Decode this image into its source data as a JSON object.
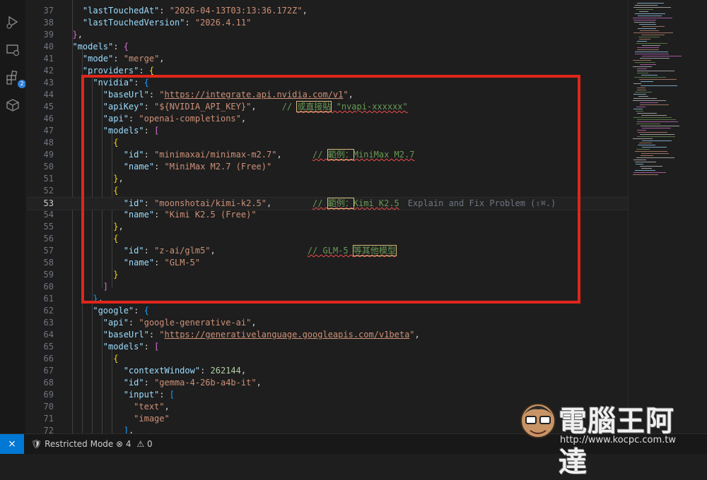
{
  "activity_bar": {
    "extensions_badge": "2"
  },
  "editor": {
    "lines": [
      {
        "n": "37",
        "tokens": [
          [
            "p",
            "    "
          ],
          [
            "k",
            "\"lastTouchedAt\""
          ],
          [
            "p",
            ": "
          ],
          [
            "s",
            "\"2026-04-13T03:13:36.172Z\""
          ],
          [
            "p",
            ","
          ]
        ]
      },
      {
        "n": "38",
        "tokens": [
          [
            "p",
            "    "
          ],
          [
            "k",
            "\"lastTouchedVersion\""
          ],
          [
            "p",
            ": "
          ],
          [
            "s",
            "\"2026.4.11\""
          ]
        ]
      },
      {
        "n": "39",
        "tokens": [
          [
            "p",
            "  "
          ],
          [
            "b1",
            "}"
          ],
          [
            "p",
            ","
          ]
        ]
      },
      {
        "n": "40",
        "tokens": [
          [
            "p",
            "  "
          ],
          [
            "k",
            "\"models\""
          ],
          [
            "p",
            ": "
          ],
          [
            "b1",
            "{"
          ]
        ]
      },
      {
        "n": "41",
        "tokens": [
          [
            "p",
            "    "
          ],
          [
            "k",
            "\"mode\""
          ],
          [
            "p",
            ": "
          ],
          [
            "s",
            "\"merge\""
          ],
          [
            "p",
            ","
          ]
        ]
      },
      {
        "n": "42",
        "tokens": [
          [
            "p",
            "    "
          ],
          [
            "k",
            "\"providers\""
          ],
          [
            "p",
            ": "
          ],
          [
            "b2",
            "{"
          ]
        ]
      },
      {
        "n": "43",
        "tokens": [
          [
            "p",
            "      "
          ],
          [
            "k",
            "\"nvidia\""
          ],
          [
            "p",
            ": "
          ],
          [
            "b3",
            "{"
          ]
        ]
      },
      {
        "n": "44",
        "tokens": [
          [
            "p",
            "        "
          ],
          [
            "k",
            "\"baseUrl\""
          ],
          [
            "p",
            ": "
          ],
          [
            "s",
            "\""
          ],
          [
            "s url",
            "https://integrate.api.nvidia.com/v1"
          ],
          [
            "s",
            "\""
          ],
          [
            "p",
            ","
          ]
        ]
      },
      {
        "n": "45",
        "tokens": [
          [
            "p",
            "        "
          ],
          [
            "k",
            "\"apiKey\""
          ],
          [
            "p",
            ": "
          ],
          [
            "s",
            "\"${NVIDIA_API_KEY}\""
          ],
          [
            "p",
            ",     "
          ],
          [
            "c",
            "// "
          ],
          [
            "c squig box",
            "或直接貼"
          ],
          [
            "c squig",
            " \"nvapi-xxxxxx\""
          ]
        ]
      },
      {
        "n": "46",
        "tokens": [
          [
            "p",
            "        "
          ],
          [
            "k",
            "\"api\""
          ],
          [
            "p",
            ": "
          ],
          [
            "s",
            "\"openai-completions\""
          ],
          [
            "p",
            ","
          ]
        ]
      },
      {
        "n": "47",
        "tokens": [
          [
            "p",
            "        "
          ],
          [
            "k",
            "\"models\""
          ],
          [
            "p",
            ": "
          ],
          [
            "b1",
            "["
          ]
        ]
      },
      {
        "n": "48",
        "tokens": [
          [
            "p",
            "          "
          ],
          [
            "b2",
            "{"
          ]
        ]
      },
      {
        "n": "49",
        "tokens": [
          [
            "p",
            "            "
          ],
          [
            "k",
            "\"id\""
          ],
          [
            "p",
            ": "
          ],
          [
            "s",
            "\"minimaxai/minimax-m2.7\""
          ],
          [
            "p",
            ",      "
          ],
          [
            "c squig",
            "// "
          ],
          [
            "c squig box",
            "範例："
          ],
          [
            "c squig",
            "MiniMax M2.7"
          ]
        ]
      },
      {
        "n": "50",
        "tokens": [
          [
            "p",
            "            "
          ],
          [
            "k",
            "\"name\""
          ],
          [
            "p",
            ": "
          ],
          [
            "s",
            "\"MiniMax M2.7 (Free)\""
          ]
        ]
      },
      {
        "n": "51",
        "tokens": [
          [
            "p",
            "          "
          ],
          [
            "b2",
            "}"
          ],
          [
            "p",
            ","
          ]
        ]
      },
      {
        "n": "52",
        "tokens": [
          [
            "p",
            "          "
          ],
          [
            "b2",
            "{"
          ]
        ]
      },
      {
        "n": "53",
        "tokens": [
          [
            "p",
            "            "
          ],
          [
            "k",
            "\"id\""
          ],
          [
            "p",
            ": "
          ],
          [
            "s",
            "\"moonshotai/kimi-k2.5\""
          ],
          [
            "p",
            ",        "
          ],
          [
            "c squig",
            "// "
          ],
          [
            "c squig box",
            "範例："
          ],
          [
            "c squig",
            "Kimi K2.5"
          ],
          [
            "hint",
            "Explain and Fix Problem (⇧⌘.)"
          ]
        ],
        "active": true
      },
      {
        "n": "54",
        "tokens": [
          [
            "p",
            "            "
          ],
          [
            "k",
            "\"name\""
          ],
          [
            "p",
            ": "
          ],
          [
            "s",
            "\"Kimi K2.5 (Free)\""
          ]
        ]
      },
      {
        "n": "55",
        "tokens": [
          [
            "p",
            "          "
          ],
          [
            "b2",
            "}"
          ],
          [
            "p",
            ","
          ]
        ]
      },
      {
        "n": "56",
        "tokens": [
          [
            "p",
            "          "
          ],
          [
            "b2",
            "{"
          ]
        ]
      },
      {
        "n": "57",
        "tokens": [
          [
            "p",
            "            "
          ],
          [
            "k",
            "\"id\""
          ],
          [
            "p",
            ": "
          ],
          [
            "s",
            "\"z-ai/glm5\""
          ],
          [
            "p",
            ",                  "
          ],
          [
            "c squig",
            "// GLM-5 "
          ],
          [
            "c squig box",
            "等其他模型"
          ]
        ]
      },
      {
        "n": "58",
        "tokens": [
          [
            "p",
            "            "
          ],
          [
            "k",
            "\"name\""
          ],
          [
            "p",
            ": "
          ],
          [
            "s",
            "\"GLM-5\""
          ]
        ]
      },
      {
        "n": "59",
        "tokens": [
          [
            "p",
            "          "
          ],
          [
            "b2",
            "}"
          ]
        ]
      },
      {
        "n": "60",
        "tokens": [
          [
            "p",
            "        "
          ],
          [
            "b1",
            "]"
          ]
        ]
      },
      {
        "n": "61",
        "tokens": [
          [
            "p",
            "      "
          ],
          [
            "b3",
            "}"
          ],
          [
            "p",
            ","
          ]
        ]
      },
      {
        "n": "62",
        "tokens": [
          [
            "p",
            "      "
          ],
          [
            "k",
            "\"google\""
          ],
          [
            "p",
            ": "
          ],
          [
            "b3",
            "{"
          ]
        ]
      },
      {
        "n": "63",
        "tokens": [
          [
            "p",
            "        "
          ],
          [
            "k",
            "\"api\""
          ],
          [
            "p",
            ": "
          ],
          [
            "s",
            "\"google-generative-ai\""
          ],
          [
            "p",
            ","
          ]
        ]
      },
      {
        "n": "64",
        "tokens": [
          [
            "p",
            "        "
          ],
          [
            "k",
            "\"baseUrl\""
          ],
          [
            "p",
            ": "
          ],
          [
            "s",
            "\""
          ],
          [
            "s url",
            "https://generativelanguage.googleapis.com/v1beta"
          ],
          [
            "s",
            "\""
          ],
          [
            "p",
            ","
          ]
        ]
      },
      {
        "n": "65",
        "tokens": [
          [
            "p",
            "        "
          ],
          [
            "k",
            "\"models\""
          ],
          [
            "p",
            ": "
          ],
          [
            "b1",
            "["
          ]
        ]
      },
      {
        "n": "66",
        "tokens": [
          [
            "p",
            "          "
          ],
          [
            "b2",
            "{"
          ]
        ]
      },
      {
        "n": "67",
        "tokens": [
          [
            "p",
            "            "
          ],
          [
            "k",
            "\"contextWindow\""
          ],
          [
            "p",
            ": "
          ],
          [
            "n",
            "262144"
          ],
          [
            "p",
            ","
          ]
        ]
      },
      {
        "n": "68",
        "tokens": [
          [
            "p",
            "            "
          ],
          [
            "k",
            "\"id\""
          ],
          [
            "p",
            ": "
          ],
          [
            "s",
            "\"gemma-4-26b-a4b-it\""
          ],
          [
            "p",
            ","
          ]
        ]
      },
      {
        "n": "69",
        "tokens": [
          [
            "p",
            "            "
          ],
          [
            "k",
            "\"input\""
          ],
          [
            "p",
            ": "
          ],
          [
            "b3",
            "["
          ]
        ]
      },
      {
        "n": "70",
        "tokens": [
          [
            "p",
            "              "
          ],
          [
            "s",
            "\"text\""
          ],
          [
            "p",
            ","
          ]
        ]
      },
      {
        "n": "71",
        "tokens": [
          [
            "p",
            "              "
          ],
          [
            "s",
            "\"image\""
          ]
        ]
      },
      {
        "n": "72",
        "tokens": [
          [
            "p",
            "            "
          ],
          [
            "b3",
            "]"
          ],
          [
            "p",
            ","
          ]
        ]
      }
    ]
  },
  "status_bar": {
    "restricted_mode": "Restricted Mode",
    "errors": "4",
    "warnings": "0"
  },
  "watermark": {
    "brand": "電腦王阿達",
    "url": "http://www.kocpc.com.tw"
  },
  "colors": {
    "highlight_box": "#e0261b",
    "status_remote": "#0078d4"
  }
}
